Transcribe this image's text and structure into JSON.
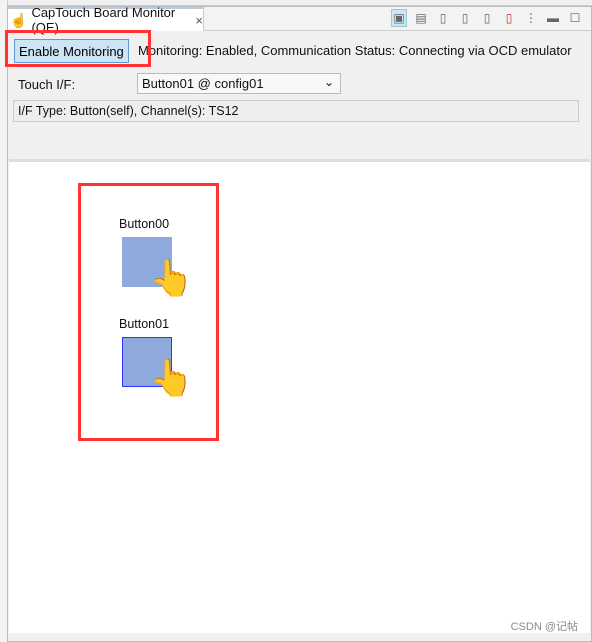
{
  "tab": {
    "title": "CapTouch Board Monitor (QE)",
    "icon": "captouch-hand-icon",
    "close": "×"
  },
  "toolbar": {
    "icons": [
      "monitor-icon",
      "chart-icon",
      "doc-arrow-icon",
      "doc-stop-icon",
      "doc-pause-icon",
      "doc-record-icon",
      "more-icon",
      "minimize-icon",
      "maximize-icon"
    ]
  },
  "controls": {
    "enable_label": "Enable Monitoring",
    "status": "Monitoring: Enabled, Communication Status: Connecting via OCD emulator",
    "touch_if_label": "Touch I/F:",
    "touch_if_value": "Button01 @ config01",
    "info": "I/F Type: Button(self), Channel(s): TS12"
  },
  "buttons": [
    {
      "label": "Button00",
      "touched": true
    },
    {
      "label": "Button01",
      "touched": true,
      "selected": true
    }
  ],
  "colors": {
    "button_fill": "#8ea9db",
    "highlight": "#ff3333"
  },
  "watermark": "CSDN @记帖"
}
